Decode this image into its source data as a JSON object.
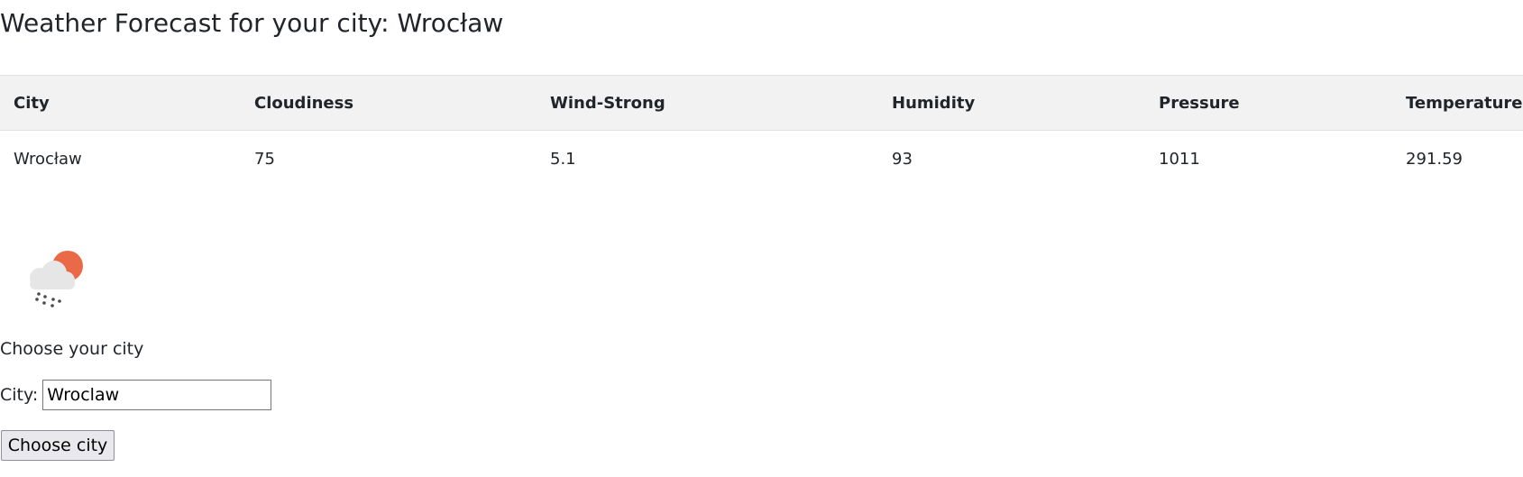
{
  "page": {
    "title": "Weather Forecast for your city: Wrocław"
  },
  "table": {
    "headers": [
      "City",
      "Cloudiness",
      "Wind-Strong",
      "Humidity",
      "Pressure",
      "Temperature"
    ],
    "rows": [
      [
        "Wrocław",
        "75",
        "5.1",
        "93",
        "1011",
        "291.59"
      ]
    ]
  },
  "weather_icon": {
    "name": "cloud-rain-sun-icon",
    "colors": {
      "sun": "#ea6a47",
      "cloud": "#e6e6e6",
      "rain": "#4a4a4a"
    }
  },
  "form": {
    "heading": "Choose your city",
    "city_label": "City:",
    "city_value": "Wroclaw",
    "submit_label": "Choose city"
  },
  "colors": {
    "header_bg": "#f2f2f2",
    "text": "#212529",
    "border": "#dee2e6"
  }
}
